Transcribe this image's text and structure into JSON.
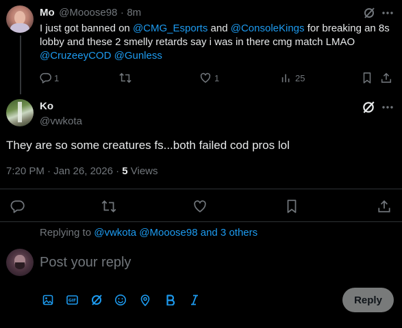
{
  "first_tweet": {
    "name": "Mo",
    "handle": "@Mooose98",
    "separator": "·",
    "time": "8m",
    "text_parts": [
      {
        "text": "I just got banned on ",
        "link": false
      },
      {
        "text": "@CMG_Esports",
        "link": true
      },
      {
        "text": " and ",
        "link": false
      },
      {
        "text": "@ConsoleKings",
        "link": true
      },
      {
        "text": " for breaking an 8s lobby and these 2 smelly retards say i was in there cmg match LMAO ",
        "link": false
      },
      {
        "text": "@CruzeeyCOD",
        "link": true
      },
      {
        "text": " ",
        "link": false
      },
      {
        "text": "@Gunless",
        "link": true
      }
    ],
    "reply_count": "1",
    "like_count": "1",
    "view_count": "25"
  },
  "main_tweet": {
    "name": "Ko",
    "handle": "@vwkota",
    "text": "They are so some creatures fs...both failed cod pros lol",
    "timestamp": "7:20 PM · Jan 26, 2026 · ",
    "views_count": "5",
    "views_label": " Views"
  },
  "replying": {
    "prefix": "Replying to ",
    "mentions": "@vwkota @Mooose98 and 3 others"
  },
  "composer": {
    "placeholder": "Post your reply",
    "reply_button": "Reply"
  },
  "colors": {
    "accent": "#1d9bf0",
    "muted": "#71767b",
    "text": "#e7e9ea",
    "divider": "#2f3336"
  }
}
